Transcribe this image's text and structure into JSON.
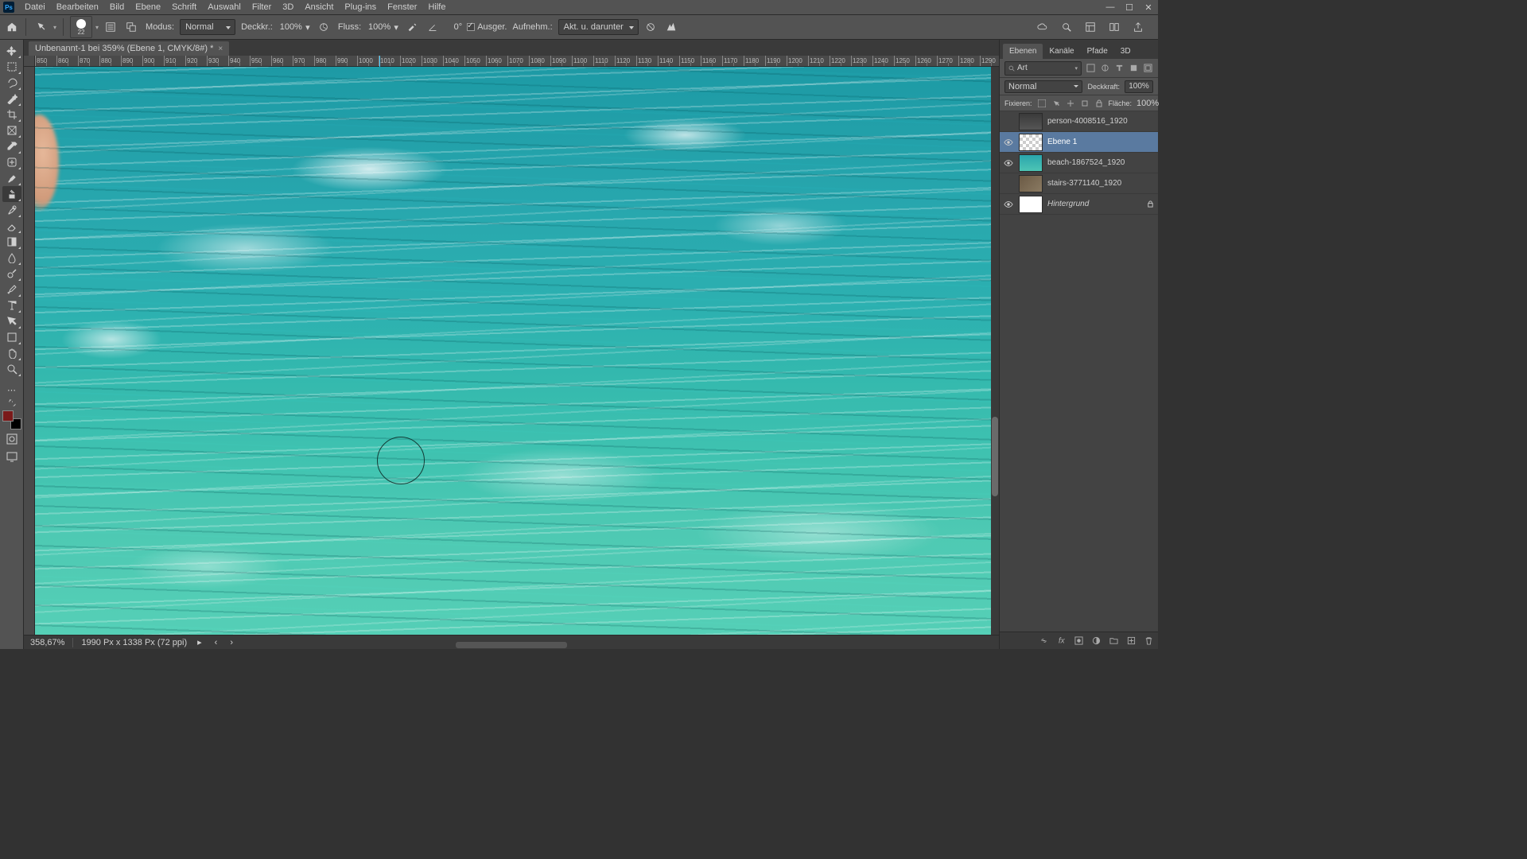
{
  "menubar": {
    "items": [
      "Datei",
      "Bearbeiten",
      "Bild",
      "Ebene",
      "Schrift",
      "Auswahl",
      "Filter",
      "3D",
      "Ansicht",
      "Plug-ins",
      "Fenster",
      "Hilfe"
    ]
  },
  "optionsbar": {
    "brush_size": "22",
    "modus_label": "Modus:",
    "modus_value": "Normal",
    "deckkr_label": "Deckkr.:",
    "deckkr_value": "100%",
    "fluss_label": "Fluss:",
    "fluss_value": "100%",
    "angle_icon_deg": "0°",
    "ausger_label": "Ausger.",
    "ausger_checked": true,
    "aufnehm_label": "Aufnehm.:",
    "sample_value": "Akt. u. darunter"
  },
  "document": {
    "tab_title": "Unbenannt-1 bei 359% (Ebene 1, CMYK/8#) *"
  },
  "ruler": {
    "start": 850,
    "step": 10,
    "count": 46
  },
  "statusbar": {
    "zoom": "358,67%",
    "dims": "1990 Px x 1338 Px (72 ppi)"
  },
  "layers_panel": {
    "tabs": [
      "Ebenen",
      "Kanäle",
      "Pfade",
      "3D"
    ],
    "active_tab": 0,
    "search_placeholder": "Art",
    "blend_mode": "Normal",
    "opacity_label": "Deckkraft:",
    "opacity_value": "100%",
    "lock_label": "Fixieren:",
    "fill_label": "Fläche:",
    "fill_value": "100%",
    "layers": [
      {
        "visible": false,
        "thumb": "dark",
        "name": "person-4008516_1920",
        "locked": false,
        "selected": false
      },
      {
        "visible": true,
        "thumb": "checker",
        "name": "Ebene 1",
        "locked": false,
        "selected": true
      },
      {
        "visible": true,
        "thumb": "water",
        "name": "beach-1867524_1920",
        "locked": false,
        "selected": false
      },
      {
        "visible": false,
        "thumb": "stairs",
        "name": "stairs-3771140_1920",
        "locked": false,
        "selected": false
      },
      {
        "visible": true,
        "thumb": "white",
        "name": "Hintergrund",
        "locked": true,
        "selected": false,
        "italic": true
      }
    ]
  },
  "tools": [
    "move",
    "marquee",
    "lasso",
    "wand",
    "crop",
    "frame",
    "eyedropper",
    "healing",
    "brush",
    "clone",
    "history-brush",
    "eraser",
    "gradient",
    "blur",
    "dodge",
    "pen",
    "type",
    "path-select",
    "shape",
    "hand",
    "zoom"
  ],
  "active_tool_index": 9
}
